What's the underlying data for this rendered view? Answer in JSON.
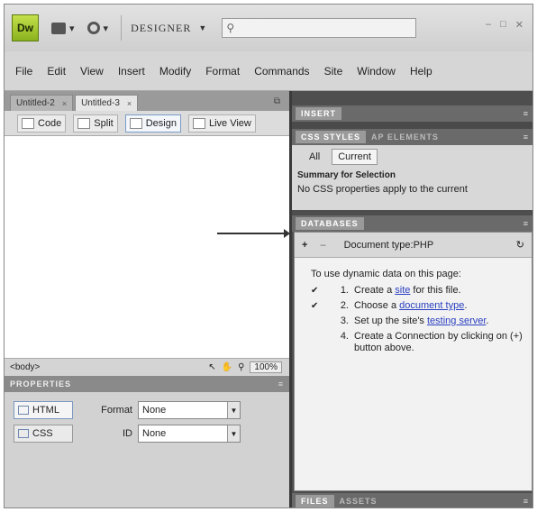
{
  "app": {
    "logo": "Dw",
    "workspace": "DESIGNER"
  },
  "menu": [
    "File",
    "Edit",
    "View",
    "Insert",
    "Modify",
    "Format",
    "Commands",
    "Site",
    "Window",
    "Help"
  ],
  "doc_tabs": [
    {
      "label": "Untitled-2",
      "close": "×"
    },
    {
      "label": "Untitled-3",
      "close": "×"
    }
  ],
  "view_buttons": {
    "code": "Code",
    "split": "Split",
    "design": "Design",
    "live": "Live View"
  },
  "status": {
    "tag": "<body>",
    "zoom": "100%"
  },
  "properties": {
    "title": "PROPERTIES",
    "html_tab": "HTML",
    "css_tab": "CSS",
    "format_label": "Format",
    "format_value": "None",
    "id_label": "ID",
    "id_value": "None"
  },
  "insert_panel": {
    "title": "INSERT"
  },
  "css_panel": {
    "tab1": "CSS STYLES",
    "tab2": "AP ELEMENTS",
    "all": "All",
    "current": "Current",
    "summary": "Summary for Selection",
    "message": "No CSS properties apply to the current"
  },
  "databases_panel": {
    "title": "DATABASES",
    "doc_type": "Document type:PHP",
    "intro": "To use dynamic data on this page:",
    "steps": [
      {
        "check": "✔",
        "num": "1.",
        "pre": "Create a ",
        "link": "site",
        "post": " for this file."
      },
      {
        "check": "✔",
        "num": "2.",
        "pre": "Choose a ",
        "link": "document type",
        "post": "."
      },
      {
        "check": "",
        "num": "3.",
        "pre": "Set up the site's ",
        "link": "testing server",
        "post": "."
      },
      {
        "check": "",
        "num": "4.",
        "pre": "Create a Connection by clicking on (+) button above.",
        "link": "",
        "post": ""
      }
    ]
  },
  "files_panel": {
    "tab1": "FILES",
    "tab2": "ASSETS"
  }
}
